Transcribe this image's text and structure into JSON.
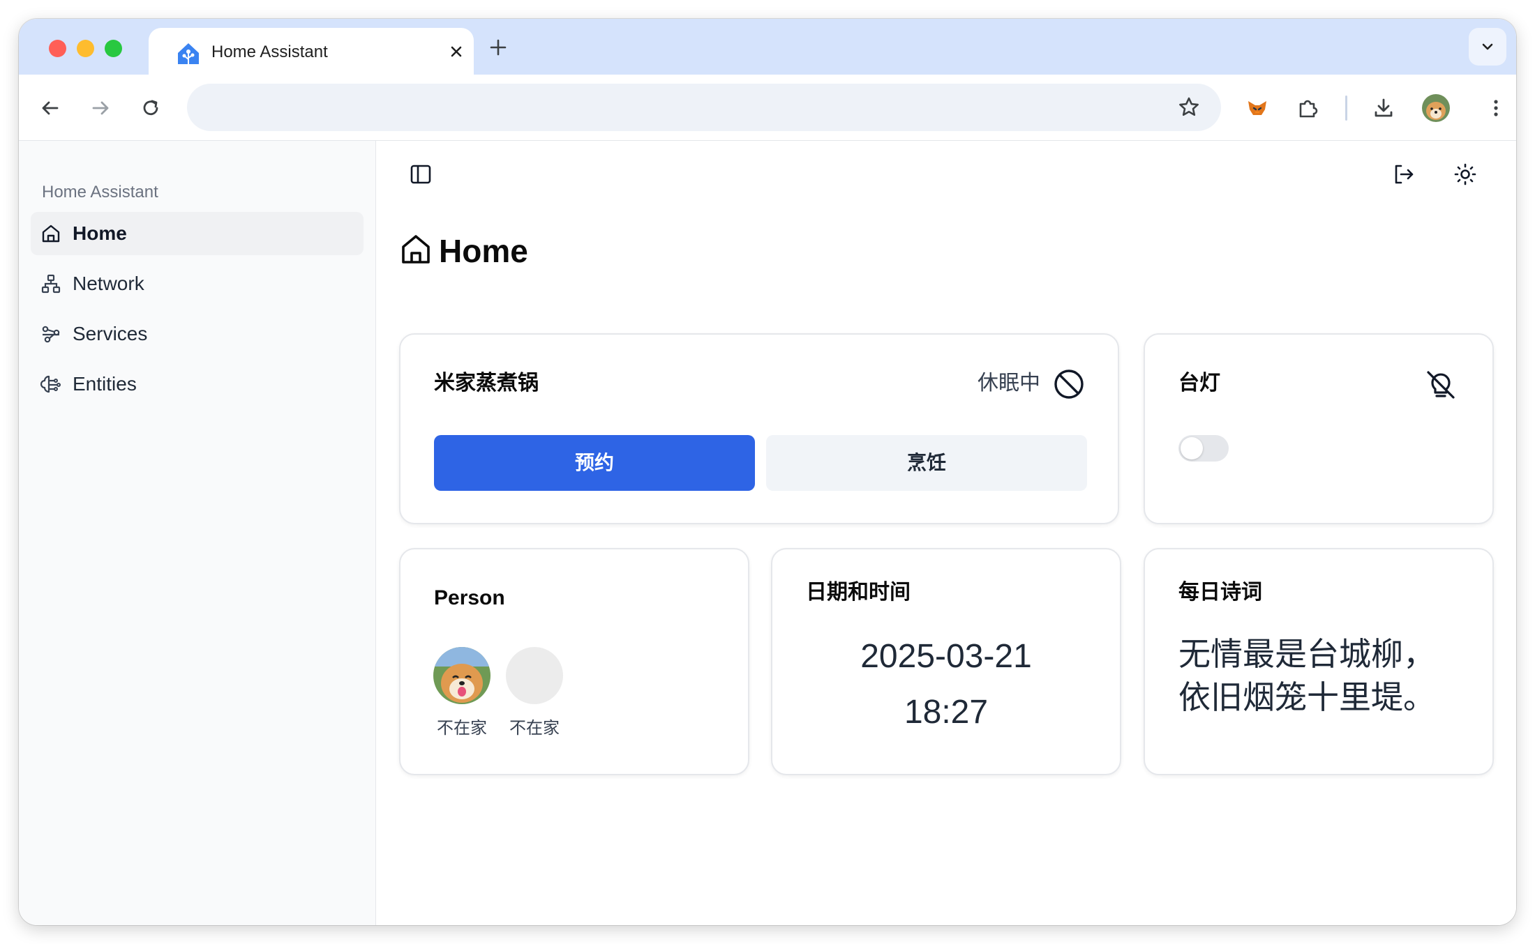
{
  "browser": {
    "tab_title": "Home Assistant",
    "address_value": "",
    "address_placeholder": ""
  },
  "sidebar": {
    "heading": "Home Assistant",
    "items": [
      {
        "label": "Home",
        "icon": "home-icon",
        "active": true
      },
      {
        "label": "Network",
        "icon": "network-icon",
        "active": false
      },
      {
        "label": "Services",
        "icon": "services-icon",
        "active": false
      },
      {
        "label": "Entities",
        "icon": "entities-icon",
        "active": false
      }
    ]
  },
  "page": {
    "title": "Home"
  },
  "cards": {
    "cooker": {
      "title": "米家蒸煮锅",
      "status": "休眠中",
      "buttons": [
        "预约",
        "烹饪"
      ]
    },
    "lamp": {
      "title": "台灯",
      "switch_on": false
    },
    "person": {
      "title": "Person",
      "people": [
        {
          "status": "不在家",
          "has_photo": true
        },
        {
          "status": "不在家",
          "has_photo": false
        }
      ]
    },
    "datetime": {
      "title": "日期和时间",
      "date": "2025-03-21",
      "time": "18:27"
    },
    "poem": {
      "title": "每日诗词",
      "lines": [
        "无情最是台城柳，",
        "依旧烟笼十里堤。"
      ]
    }
  },
  "colors": {
    "accent": "#2e64e5",
    "tabstrip": "#d5e3fc",
    "sidebar_bg": "#f9fafb"
  }
}
